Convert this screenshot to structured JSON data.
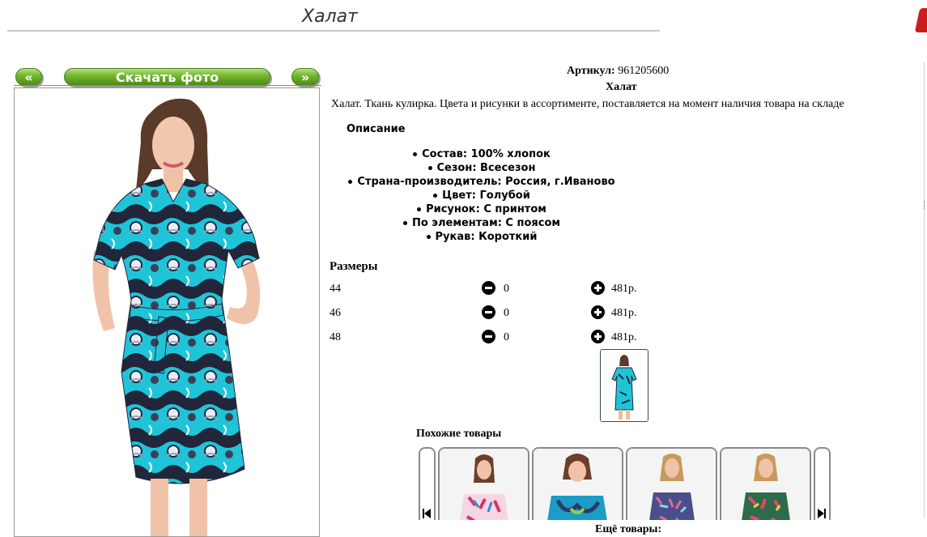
{
  "header": {
    "title": "Халат"
  },
  "photo_nav": {
    "prev_label": "«",
    "download_label": "Скачать фото",
    "next_label": "»"
  },
  "product": {
    "article_label": "Артикул:",
    "article_value": "961205600",
    "name": "Халат",
    "description": "Халат. Ткань кулирка. Цвета и рисунки в ассортименте, поставляется на момент наличия товара на складе",
    "description_heading": "Описание",
    "attributes": [
      "Состав: 100% хлопок",
      "Сезон: Всесезон",
      "Страна-производитель: Россия, г.Иваново",
      "Цвет: Голубой",
      "Рисунок: С принтом",
      "По элементам: С поясом",
      "Рукав: Короткий"
    ]
  },
  "sizes": {
    "heading": "Размеры",
    "rows": [
      {
        "size": "44",
        "qty": "0",
        "price": "481р."
      },
      {
        "size": "46",
        "qty": "0",
        "price": "481р."
      },
      {
        "size": "48",
        "qty": "0",
        "price": "481р."
      }
    ]
  },
  "similar": {
    "heading": "Похожие товары",
    "item_count": 4
  },
  "more": {
    "heading": "Ещё товары:"
  },
  "colors": {
    "button_green": "#5fa323",
    "dress_turquoise": "#1fc4d8",
    "dress_navy": "#22263a",
    "close_red": "#c81e1e"
  },
  "icons": [
    "minus-circle-icon",
    "plus-circle-icon",
    "prev-arrow-icon",
    "next-arrow-icon",
    "close-icon"
  ]
}
